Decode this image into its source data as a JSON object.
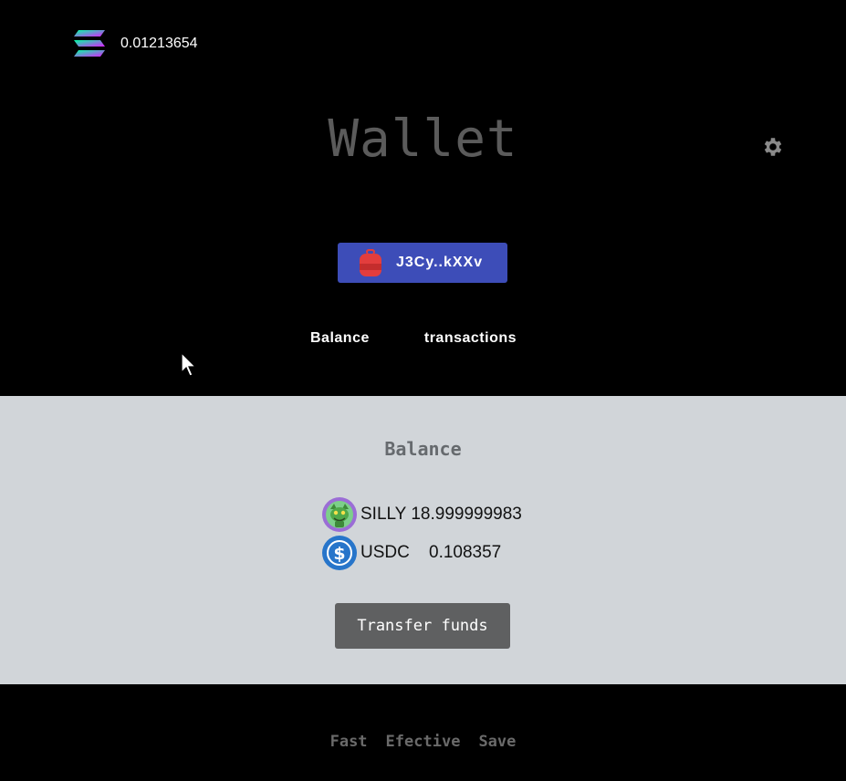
{
  "header": {
    "sol_balance": "0.01213654",
    "icon": "solana-logo-icon",
    "settings_icon": "gear-icon"
  },
  "wallet": {
    "title": "Wallet",
    "address_short": "J3Cy..kXXv",
    "address_icon": "backpack-icon",
    "address_button_color": "#3d4db8"
  },
  "tabs": [
    {
      "label": "Balance"
    },
    {
      "label": "transactions"
    }
  ],
  "balance": {
    "title": "Balance",
    "tokens": [
      {
        "symbol": "SILLY",
        "amount": "18.999999983",
        "icon": "silly-token-icon"
      },
      {
        "symbol": "USDC",
        "amount": "0.108357",
        "icon": "usdc-token-icon"
      }
    ],
    "transfer_label": "Transfer funds"
  },
  "footer": {
    "words": [
      "Fast",
      "Efective",
      "Save"
    ]
  },
  "colors": {
    "background": "#000000",
    "panel": "#d1d5d9",
    "button_gray": "#5f6061",
    "title_gray": "#5b5b5b"
  }
}
